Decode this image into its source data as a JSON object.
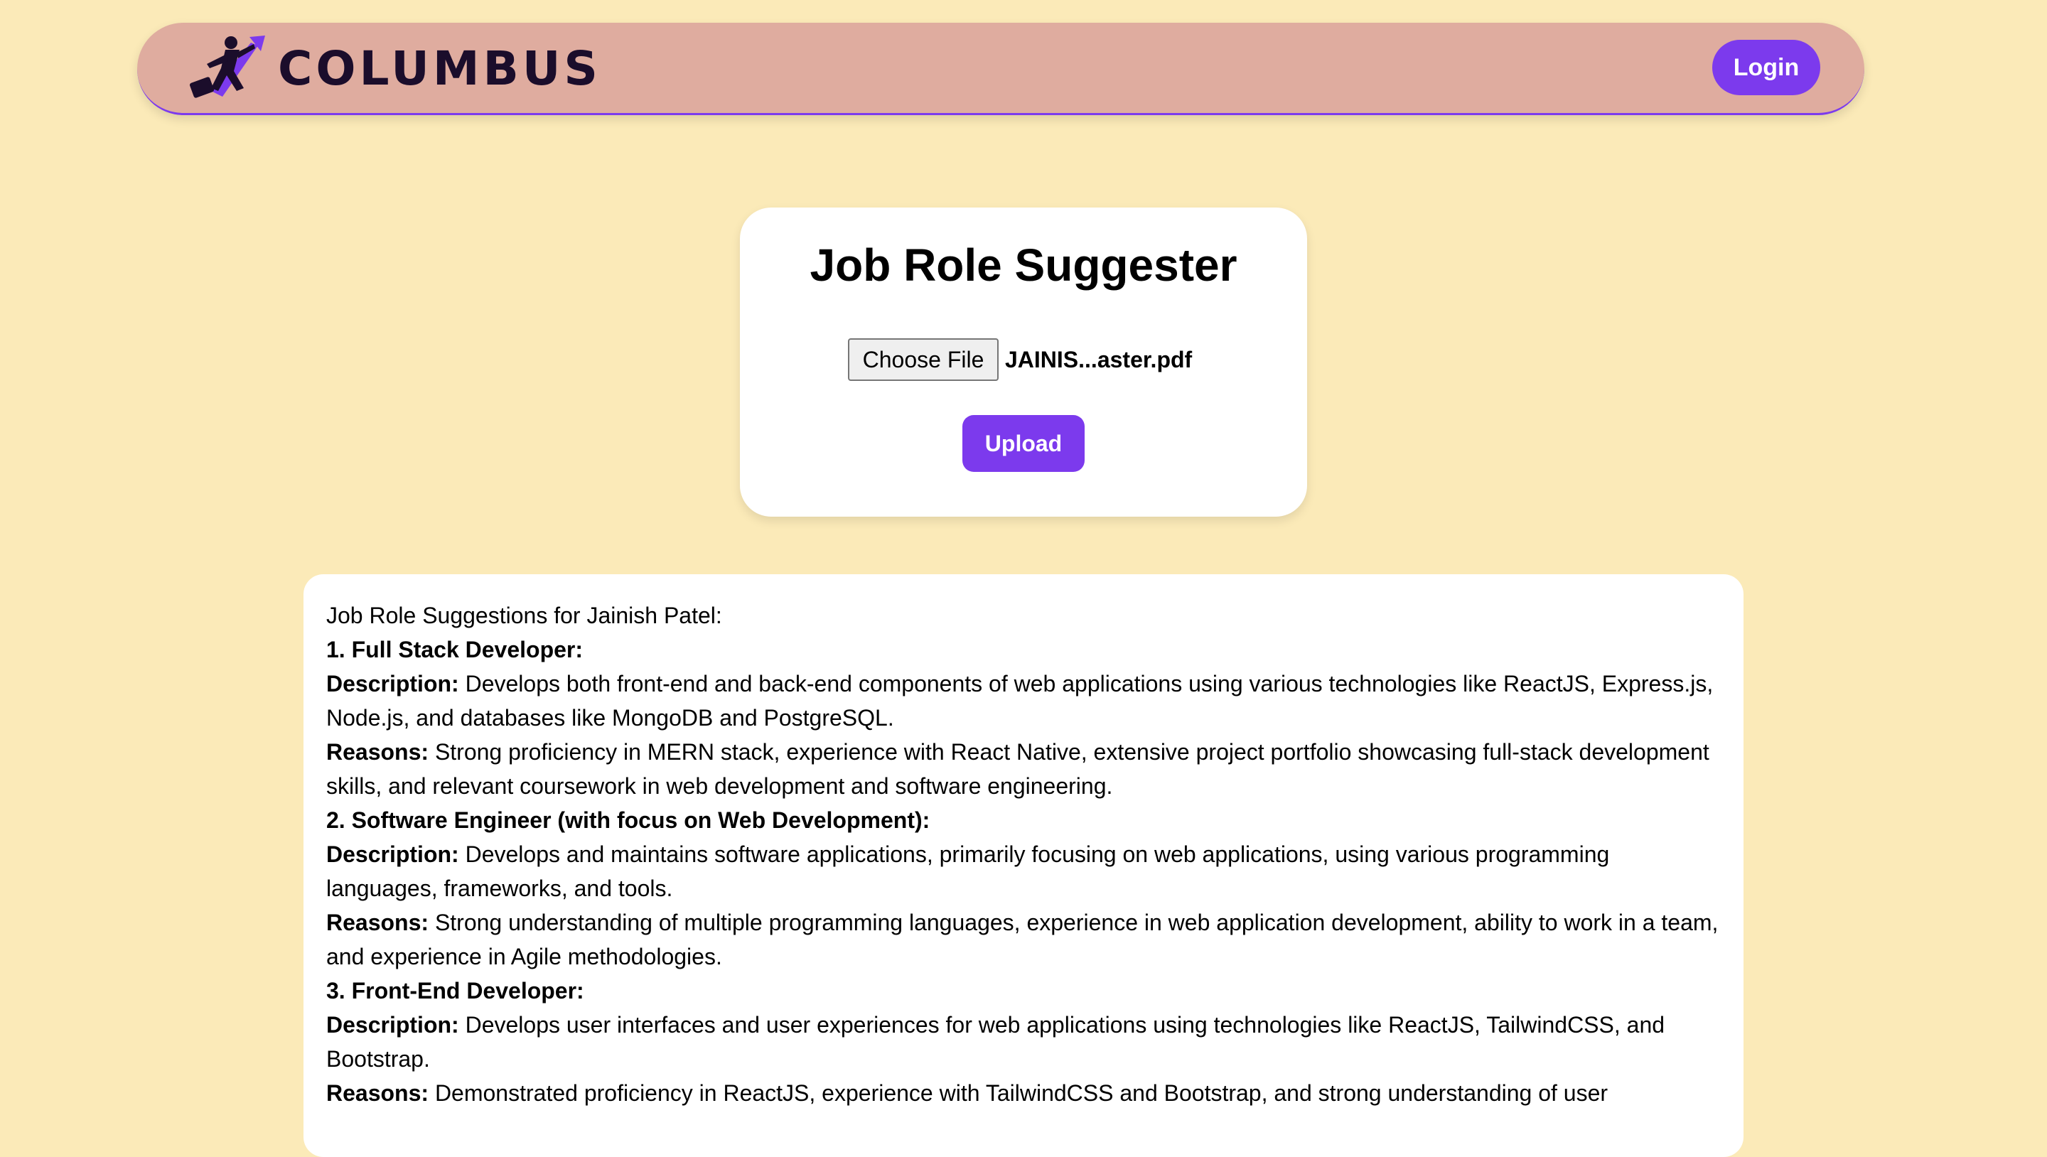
{
  "header": {
    "brand": "COLUMBUS",
    "login_label": "Login",
    "logo_icon": "rocket-man-icon",
    "accent_color": "#7c3aed"
  },
  "uploader": {
    "title": "Job Role Suggester",
    "choose_label": "Choose File",
    "file_name": "JAINIS...aster.pdf",
    "upload_label": "Upload"
  },
  "results": {
    "heading": "Job Role Suggestions for Jainish Patel:",
    "roles": [
      {
        "title": "1. Full Stack Developer:",
        "desc_label": "Description:",
        "description": " Develops both front-end and back-end components of web applications using various technologies like ReactJS, Express.js, Node.js, and databases like MongoDB and PostgreSQL.",
        "reasons_label": "Reasons:",
        "reasons": " Strong proficiency in MERN stack, experience with React Native, extensive project portfolio showcasing full-stack development skills, and relevant coursework in web development and software engineering."
      },
      {
        "title": "2. Software Engineer (with focus on Web Development):",
        "desc_label": "Description:",
        "description": " Develops and maintains software applications, primarily focusing on web applications, using various programming languages, frameworks, and tools.",
        "reasons_label": "Reasons:",
        "reasons": " Strong understanding of multiple programming languages, experience in web application development, ability to work in a team, and experience in Agile methodologies."
      },
      {
        "title": "3. Front-End Developer:",
        "desc_label": "Description:",
        "description": " Develops user interfaces and user experiences for web applications using technologies like ReactJS, TailwindCSS, and Bootstrap.",
        "reasons_label": "Reasons:",
        "reasons": " Demonstrated proficiency in ReactJS, experience with TailwindCSS and Bootstrap, and strong understanding of user"
      }
    ]
  }
}
